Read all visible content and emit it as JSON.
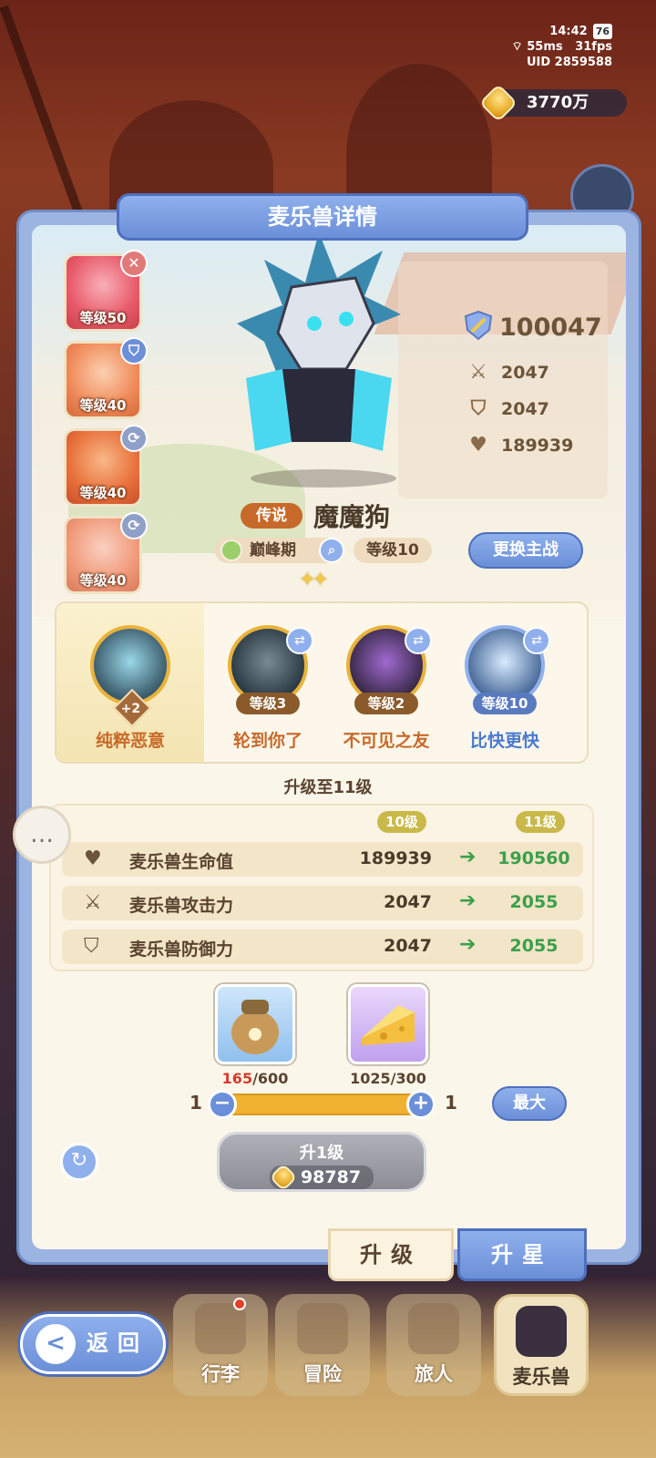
{
  "status": {
    "time": "14:42",
    "battery": "76",
    "network": "55ms",
    "fps": "31fps",
    "uid": "UID 2859588"
  },
  "currency": {
    "gold": "3770万"
  },
  "panel": {
    "title": "麦乐兽详情"
  },
  "skills": [
    {
      "level": "等级50",
      "badge": "✕",
      "badge_color": "#e07a7a",
      "art_color": "#e85a6a"
    },
    {
      "level": "等级40",
      "badge": "⛉",
      "badge_color": "#6b8fd8",
      "art_color": "#f08a5a"
    },
    {
      "level": "等级40",
      "badge": "⟳",
      "badge_color": "#8fa0c8",
      "art_color": "#e8703a"
    },
    {
      "level": "等级40",
      "badge": "⟳",
      "badge_color": "#8fa0c8",
      "art_color": "#f09a7a"
    }
  ],
  "stats": {
    "power": "100047",
    "attack": "2047",
    "defense": "2047",
    "hp": "189939",
    "icons": {
      "power": "shield-sword-icon",
      "attack": "crossed-swords-icon",
      "defense": "shield-icon",
      "hp": "heart-icon"
    }
  },
  "monster": {
    "rarity": "传说",
    "name": "魔魔狗",
    "phase": "巅峰期",
    "level": "等级10",
    "stars": "✦✦",
    "swap_label": "更换主战"
  },
  "abilities": {
    "main": {
      "name": "纯粹恶意",
      "plus": "+2"
    },
    "list": [
      {
        "name": "轮到你了",
        "level": "等级3",
        "name_color": "#c7692a",
        "ring": "#e9b23a",
        "fill": "#2a3a44"
      },
      {
        "name": "不可见之友",
        "level": "等级2",
        "name_color": "#c7692a",
        "ring": "#e9b23a",
        "fill": "#3a2a4a"
      },
      {
        "name": "比快更快",
        "level": "等级10",
        "name_color": "#4a7ad0",
        "ring": "#8fb0ec",
        "fill": "#4a6a9a"
      }
    ]
  },
  "upgrade": {
    "title": "升级至11级",
    "from_level": "10级",
    "to_level": "11级",
    "rows": [
      {
        "icon": "heart-icon",
        "glyph": "♥",
        "label": "麦乐兽生命值",
        "old": "189939",
        "new": "190560"
      },
      {
        "icon": "crossed-swords-icon",
        "glyph": "⚔",
        "label": "麦乐兽攻击力",
        "old": "2047",
        "new": "2055"
      },
      {
        "icon": "shield-icon",
        "glyph": "⛉",
        "label": "麦乐兽防御力",
        "old": "2047",
        "new": "2055"
      }
    ],
    "arrow": "➔"
  },
  "materials": [
    {
      "icon": "food-bag-icon",
      "have": "165",
      "need": "/600"
    },
    {
      "icon": "cheese-icon",
      "have": "1025",
      "need": "/300"
    }
  ],
  "quantity": {
    "min": "1",
    "value": "1",
    "minus": "−",
    "plus": "+",
    "max_label": "最大"
  },
  "levelup": {
    "label": "升1级",
    "cost": "98787"
  },
  "tabs": {
    "upgrade": "升级",
    "star": "升星"
  },
  "back": {
    "label": "返回",
    "arrow": "<"
  },
  "nav": [
    "行李",
    "冒险",
    "旅人",
    "麦乐兽"
  ],
  "chat_icon": "…",
  "refresh_icon": "↻"
}
